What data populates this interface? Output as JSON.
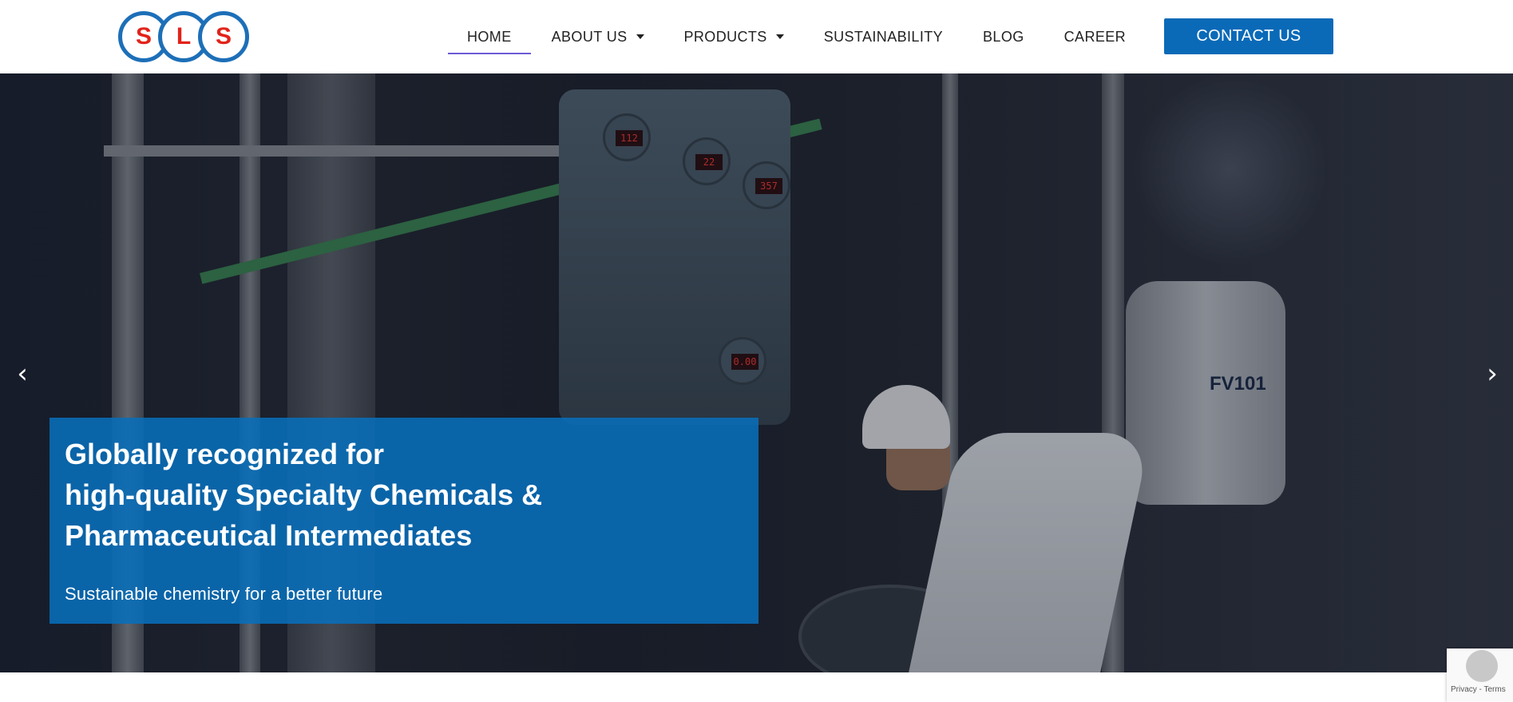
{
  "logo": {
    "letters": [
      "S",
      "L",
      "S"
    ],
    "brand_color": "#1d6fb8",
    "letter_color": "#e2231a"
  },
  "nav": {
    "items": [
      {
        "label": "HOME",
        "active": true,
        "dropdown": false
      },
      {
        "label": "ABOUT US",
        "active": false,
        "dropdown": true
      },
      {
        "label": "PRODUCTS",
        "active": false,
        "dropdown": true
      },
      {
        "label": "SUSTAINABILITY",
        "active": false,
        "dropdown": false
      },
      {
        "label": "BLOG",
        "active": false,
        "dropdown": false
      },
      {
        "label": "CAREER",
        "active": false,
        "dropdown": false
      }
    ],
    "contact_label": "CONTACT US",
    "accent_color": "#0a6ab8",
    "active_underline_color": "#6c5ad6"
  },
  "hero": {
    "headline": [
      "Globally recognized for",
      "high-quality Specialty Chemicals &",
      "Pharmaceutical Intermediates"
    ],
    "subtitle": "Sustainable chemistry for a better future",
    "caption_color": "#086eb9",
    "prev_icon": "chevron-left-icon",
    "next_icon": "chevron-right-icon",
    "prev_glyph": "‹",
    "next_glyph": "›",
    "tank_label": "FV101",
    "gauges": [
      "112",
      "22",
      "357",
      "0.00"
    ]
  },
  "recaptcha": {
    "links": "Privacy - Terms"
  }
}
